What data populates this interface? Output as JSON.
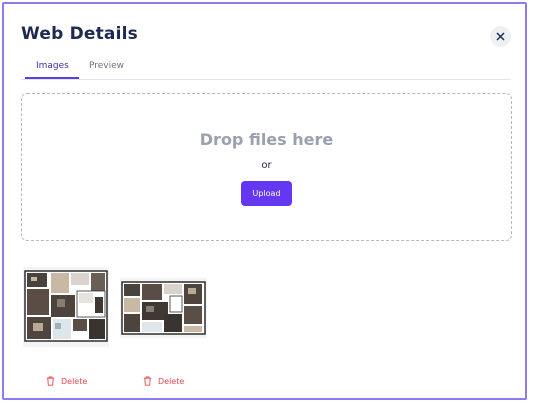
{
  "dialog": {
    "title": "Web Details"
  },
  "tabs": [
    {
      "label": "Images",
      "active": true
    },
    {
      "label": "Preview",
      "active": false
    }
  ],
  "dropzone": {
    "title": "Drop files here",
    "or_text": "or",
    "upload_label": "Upload"
  },
  "images": [
    {
      "delete_label": "Delete"
    },
    {
      "delete_label": "Delete"
    }
  ],
  "icons": {
    "close": "close-icon",
    "delete": "trash-icon"
  },
  "colors": {
    "accent": "#6437f3",
    "danger": "#e5484d",
    "title": "#1e2a4f",
    "modal_border": "#8b7cf2"
  }
}
